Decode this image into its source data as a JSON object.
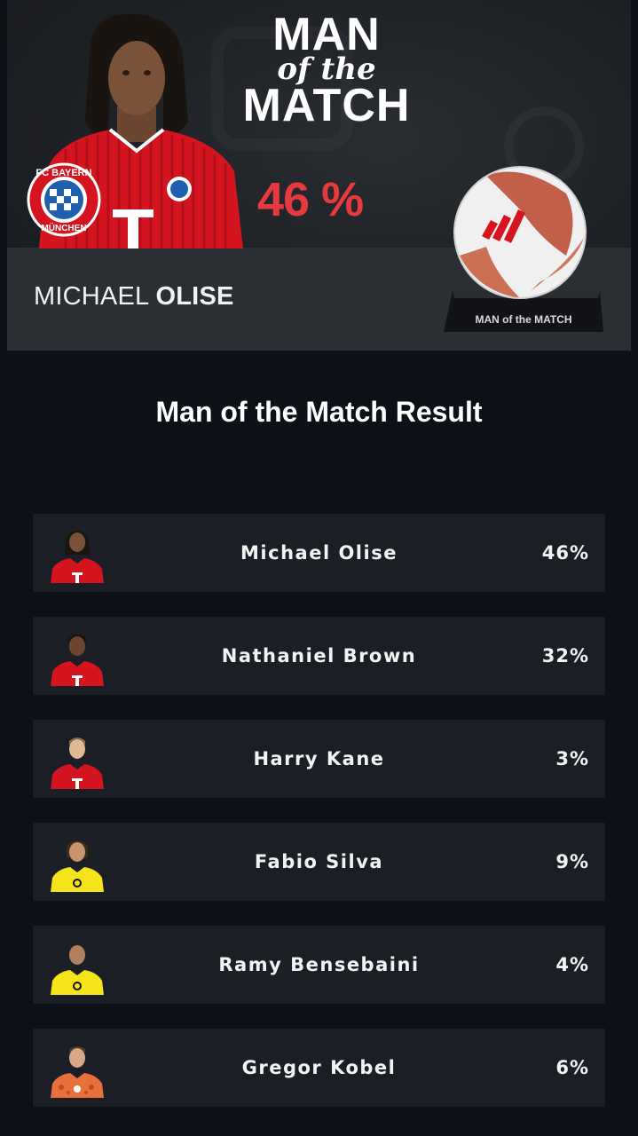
{
  "hero": {
    "title_line1": "MAN",
    "title_line2": "of the",
    "title_line3": "MATCH",
    "percent": "46 %",
    "player_first": "MICHAEL",
    "player_last": "OLISE",
    "club_badge_text": "FC BAYERN MÜNCHEN",
    "trophy_label": "MAN of the MATCH"
  },
  "results": {
    "title": "Man of the Match Result",
    "rows": [
      {
        "name": "Michael Olise",
        "percent": "46%",
        "kit": "bayern"
      },
      {
        "name": "Nathaniel Brown",
        "percent": "32%",
        "kit": "bayern"
      },
      {
        "name": "Harry Kane",
        "percent": "3%",
        "kit": "bayern"
      },
      {
        "name": "Fabio Silva",
        "percent": "9%",
        "kit": "dortmund"
      },
      {
        "name": "Ramy Bensebaini",
        "percent": "4%",
        "kit": "dortmund"
      },
      {
        "name": "Gregor Kobel",
        "percent": "6%",
        "kit": "keeper"
      }
    ]
  },
  "colors": {
    "background": "#0c1118",
    "row_bg": "#1b1e24",
    "accent_red": "#e83a3e",
    "bayern_red": "#d4141f",
    "dortmund_yellow": "#f5e41a"
  }
}
